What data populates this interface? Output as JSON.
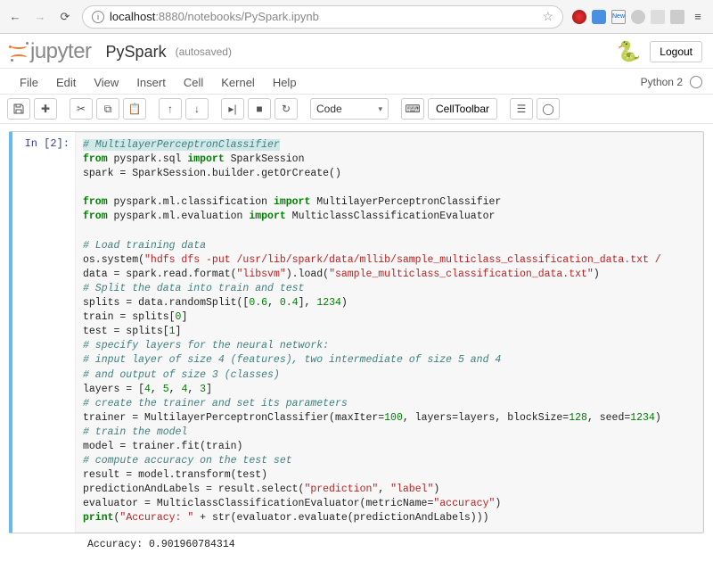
{
  "browser": {
    "url_host": "localhost",
    "url_port": ":8880",
    "url_path": "/notebooks/PySpark.ipynb"
  },
  "header": {
    "logo_text": "jupyter",
    "nb_name": "PySpark",
    "autosave": "(autosaved)",
    "logout": "Logout",
    "kernel_name": "Python 2"
  },
  "menu": {
    "file": "File",
    "edit": "Edit",
    "view": "View",
    "insert": "Insert",
    "cell": "Cell",
    "kernel": "Kernel",
    "help": "Help"
  },
  "toolbar": {
    "cell_type": "Code",
    "cell_toolbar": "CellToolbar"
  },
  "cell": {
    "prompt": "In [2]:",
    "output": "Accuracy: 0.901960784314",
    "code": {
      "l1": "# MultilayerPerceptronClassifier",
      "l2a": "from",
      "l2b": " pyspark.sql ",
      "l2c": "import",
      "l2d": " SparkSession",
      "l3": "spark = SparkSession.builder.getOrCreate()",
      "l4a": "from",
      "l4b": " pyspark.ml.classification ",
      "l4c": "import",
      "l4d": " MultilayerPerceptronClassifier",
      "l5a": "from",
      "l5b": " pyspark.ml.evaluation ",
      "l5c": "import",
      "l5d": " MulticlassClassificationEvaluator",
      "l6": "# Load training data",
      "l7a": "os.system(",
      "l7b": "\"hdfs dfs -put /usr/lib/spark/data/mllib/sample_multiclass_classification_data.txt /",
      "l8a": "data = spark.read.format(",
      "l8b": "\"libsvm\"",
      "l8c": ").load(",
      "l8d": "\"sample_multiclass_classification_data.txt\"",
      "l8e": ")",
      "l9": "# Split the data into train and test",
      "l10a": "splits = data.randomSplit([",
      "l10b": "0.6",
      "l10c": ", ",
      "l10d": "0.4",
      "l10e": "], ",
      "l10f": "1234",
      "l10g": ")",
      "l11a": "train = splits[",
      "l11b": "0",
      "l11c": "]",
      "l12a": "test = splits[",
      "l12b": "1",
      "l12c": "]",
      "l13": "# specify layers for the neural network:",
      "l14": "# input layer of size 4 (features), two intermediate of size 5 and 4",
      "l15": "# and output of size 3 (classes)",
      "l16a": "layers = [",
      "l16b": "4",
      "l16c": ", ",
      "l16d": "5",
      "l16e": ", ",
      "l16f": "4",
      "l16g": ", ",
      "l16h": "3",
      "l16i": "]",
      "l17": "# create the trainer and set its parameters",
      "l18a": "trainer = MultilayerPerceptronClassifier(maxIter=",
      "l18b": "100",
      "l18c": ", layers=layers, blockSize=",
      "l18d": "128",
      "l18e": ", seed=",
      "l18f": "1234",
      "l18g": ")",
      "l19": "# train the model",
      "l20": "model = trainer.fit(train)",
      "l21": "# compute accuracy on the test set",
      "l22": "result = model.transform(test)",
      "l23a": "predictionAndLabels = result.select(",
      "l23b": "\"prediction\"",
      "l23c": ", ",
      "l23d": "\"label\"",
      "l23e": ")",
      "l24a": "evaluator = MulticlassClassificationEvaluator(metricName=",
      "l24b": "\"accuracy\"",
      "l24c": ")",
      "l25a": "print",
      "l25b": "(",
      "l25c": "\"Accuracy: \"",
      "l25d": " + str(evaluator.evaluate(predictionAndLabels)))"
    }
  }
}
